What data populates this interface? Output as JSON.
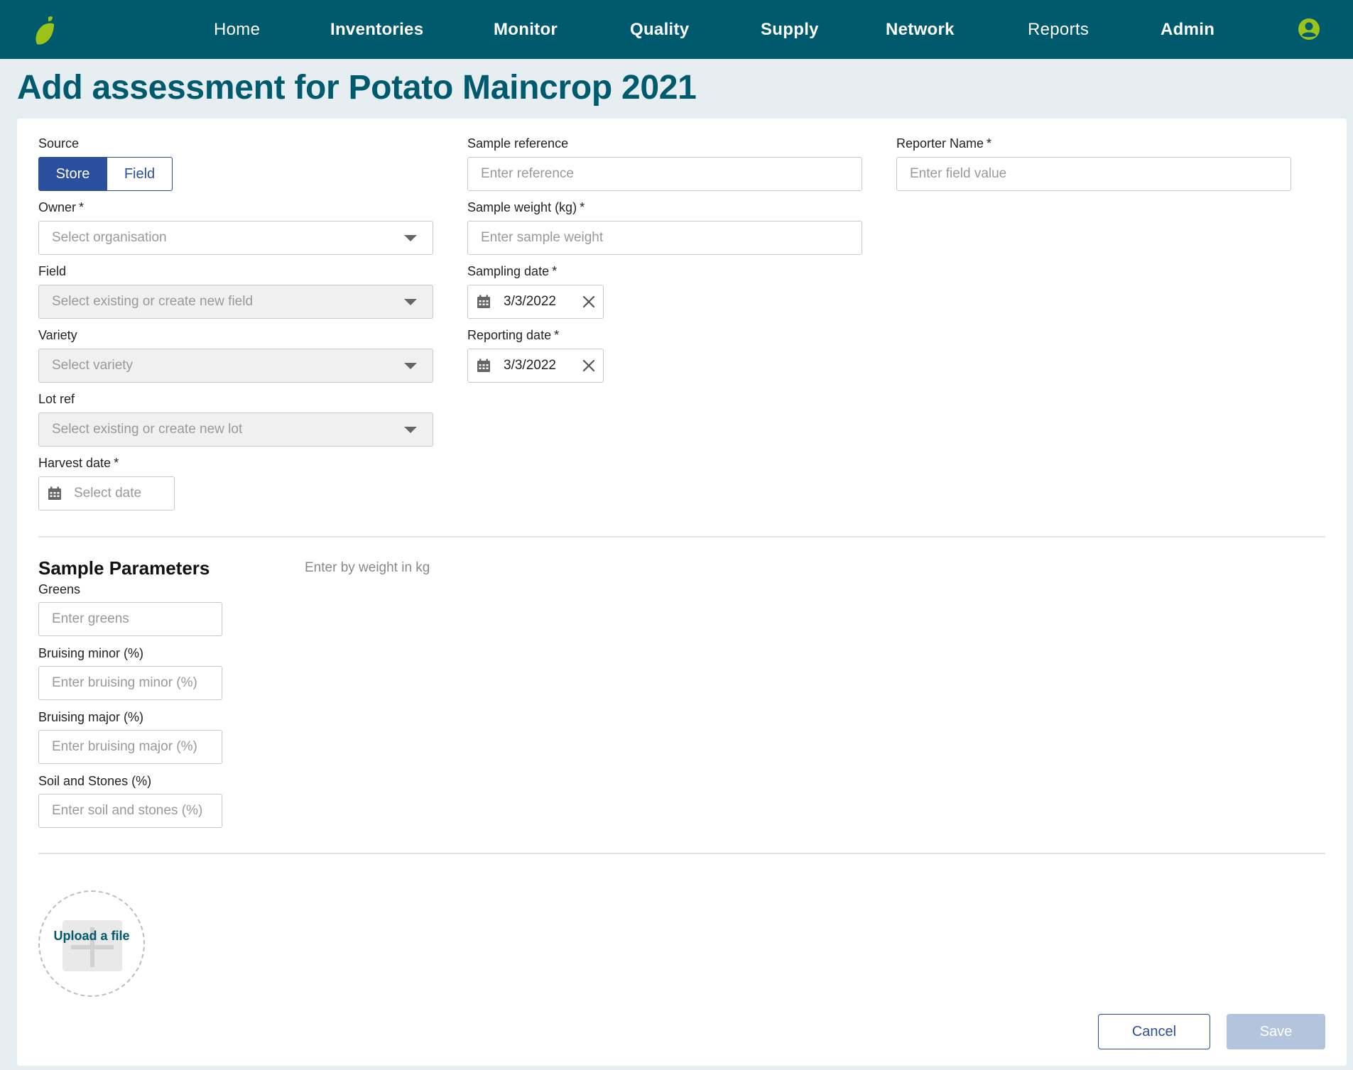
{
  "nav": {
    "items": [
      "Home",
      "Inventories",
      "Monitor",
      "Quality",
      "Supply",
      "Network",
      "Reports",
      "Admin"
    ],
    "brand_color": "#005a6e",
    "logo_icon": "leaf-logo",
    "user_icon": "user-avatar-icon"
  },
  "page": {
    "title": "Add assessment for Potato Maincrop 2021"
  },
  "form": {
    "required_mark": "*",
    "source": {
      "label": "Source",
      "options": [
        "Store",
        "Field"
      ],
      "selected": "Store"
    },
    "owner": {
      "label": "Owner",
      "placeholder": "Select organisation"
    },
    "field": {
      "label": "Field",
      "placeholder": "Select existing or create new field"
    },
    "variety": {
      "label": "Variety",
      "placeholder": "Select variety"
    },
    "lot_ref": {
      "label": "Lot ref",
      "placeholder": "Select existing or create new lot"
    },
    "harvest_date": {
      "label": "Harvest date",
      "placeholder": "Select date"
    },
    "sample_reference": {
      "label": "Sample reference",
      "placeholder": "Enter reference"
    },
    "sample_weight": {
      "label": "Sample weight (kg)",
      "placeholder": "Enter sample weight"
    },
    "sampling_date": {
      "label": "Sampling date",
      "value": "3/3/2022"
    },
    "reporting_date": {
      "label": "Reporting date",
      "value": "3/3/2022"
    },
    "reporter_name": {
      "label": "Reporter Name",
      "placeholder": "Enter field value"
    }
  },
  "sample_parameters": {
    "title": "Sample Parameters",
    "hint": "Enter by weight in kg",
    "fields": [
      {
        "label": "Greens",
        "placeholder": "Enter greens"
      },
      {
        "label": "Bruising minor (%)",
        "placeholder": "Enter bruising minor (%)"
      },
      {
        "label": "Bruising major (%)",
        "placeholder": "Enter bruising major (%)"
      },
      {
        "label": "Soil and Stones (%)",
        "placeholder": "Enter soil and stones (%)"
      }
    ]
  },
  "upload": {
    "label": "Upload a file"
  },
  "actions": {
    "cancel": "Cancel",
    "save": "Save"
  },
  "colors": {
    "accent": "#2a4f9c",
    "title": "#005a6e",
    "logo_green": "#9bc31a",
    "save_disabled": "#b3c4dc"
  }
}
